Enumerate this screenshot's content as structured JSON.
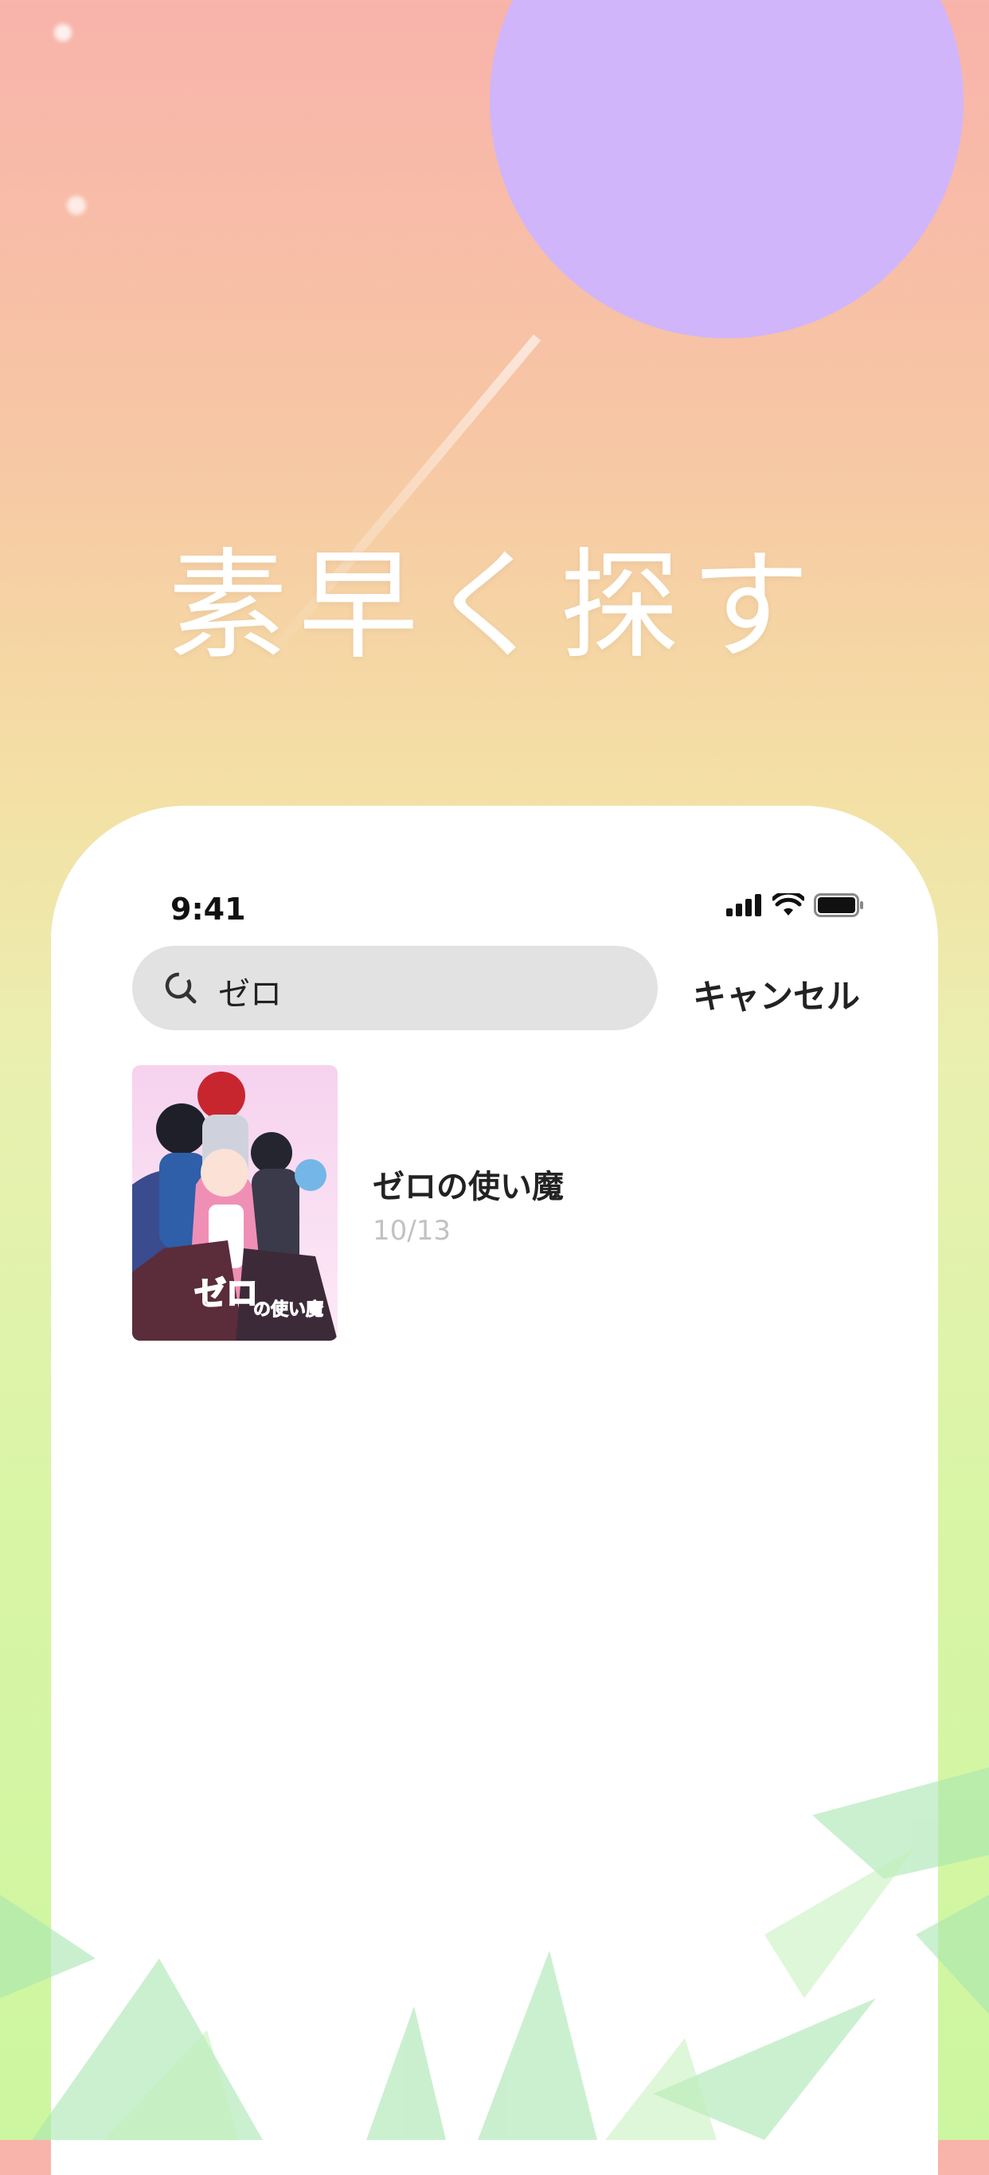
{
  "headline": "素早く探す",
  "status_bar": {
    "time": "9:41"
  },
  "search": {
    "query": "ゼロ",
    "cancel_label": "キャンセル"
  },
  "results": [
    {
      "title": "ゼロの使い魔",
      "date": "10/13",
      "poster_text": "ゼロの使い魔"
    }
  ],
  "colors": {
    "moon": "#d0b5fb",
    "search_bg": "#e2e2e2",
    "date_gray": "#c2c2c2"
  },
  "icons": [
    "search-icon",
    "signal-icon",
    "wifi-icon",
    "battery-icon"
  ]
}
